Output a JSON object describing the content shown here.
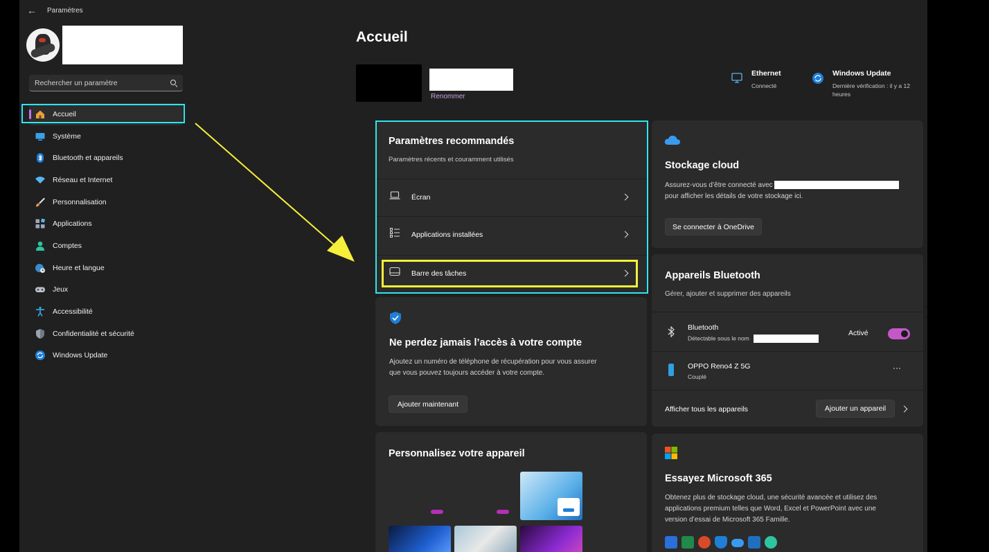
{
  "window": {
    "title": "Paramètres",
    "back_icon": "back-arrow-icon"
  },
  "sidebar": {
    "search": {
      "placeholder": "Rechercher un paramètre"
    },
    "items": [
      {
        "label": "Accueil",
        "icon": "home-icon",
        "active": true
      },
      {
        "label": "Système",
        "icon": "display-icon"
      },
      {
        "label": "Bluetooth et appareils",
        "icon": "bluetooth-icon"
      },
      {
        "label": "Réseau et Internet",
        "icon": "wifi-icon"
      },
      {
        "label": "Personnalisation",
        "icon": "brush-icon"
      },
      {
        "label": "Applications",
        "icon": "apps-icon"
      },
      {
        "label": "Comptes",
        "icon": "account-icon"
      },
      {
        "label": "Heure et langue",
        "icon": "globe-clock-icon"
      },
      {
        "label": "Jeux",
        "icon": "gamepad-icon"
      },
      {
        "label": "Accessibilité",
        "icon": "accessibility-icon"
      },
      {
        "label": "Confidentialité et sécurité",
        "icon": "shield-icon"
      },
      {
        "label": "Windows Update",
        "icon": "update-icon"
      }
    ]
  },
  "main": {
    "title": "Accueil",
    "device": {
      "rename_label": "Renommer"
    },
    "status": {
      "ethernet": {
        "title": "Ethernet",
        "subtitle": "Connecté"
      },
      "update": {
        "title": "Windows Update",
        "subtitle_line1": "Dernière vérification : il y a 12",
        "subtitle_line2": "heures"
      }
    },
    "recommended": {
      "title": "Paramètres recommandés",
      "subtitle": "Paramètres récents et couramment utilisés",
      "rows": [
        {
          "label": "Écran",
          "icon": "laptop-icon"
        },
        {
          "label": "Applications installées",
          "icon": "list-icon"
        },
        {
          "label": "Barre des tâches",
          "icon": "taskbar-icon"
        }
      ]
    },
    "account": {
      "title": "Ne perdez jamais l’accès à votre compte",
      "text_line1": "Ajoutez un numéro de téléphone de récupération pour vous assurer",
      "text_line2": "que vous pouvez toujours accéder à votre compte.",
      "button": "Ajouter maintenant"
    },
    "personalize": {
      "title": "Personnalisez votre appareil"
    },
    "cloud": {
      "title": "Stockage cloud",
      "text_line1": "Assurez-vous d’être connecté avec",
      "text_line2": "pour afficher les détails de votre stockage ici.",
      "button": "Se connecter à OneDrive"
    },
    "bluetooth": {
      "title": "Appareils Bluetooth",
      "subtitle": "Gérer, ajouter et supprimer des appareils",
      "bt_name": "Bluetooth",
      "bt_sub": "Détectable sous le nom",
      "bt_state": "Activé",
      "device_name": "OPPO Reno4 Z 5G",
      "device_state": "Couplé",
      "more_label": "···",
      "show_all": "Afficher tous les appareils",
      "add_button": "Ajouter un appareil"
    },
    "m365": {
      "title": "Essayez Microsoft 365",
      "text_line1": "Obtenez plus de stockage cloud, une sécurité avancée et utilisez des",
      "text_line2": "applications premium telles que Word, Excel et PowerPoint avec une",
      "text_line3": "version d’essai de Microsoft 365 Famille."
    }
  },
  "colors": {
    "accent": "#c471ed",
    "highlight_cyan": "#2ee6f0",
    "highlight_yellow": "#f7f03a",
    "toggle_on": "#c458c8"
  }
}
